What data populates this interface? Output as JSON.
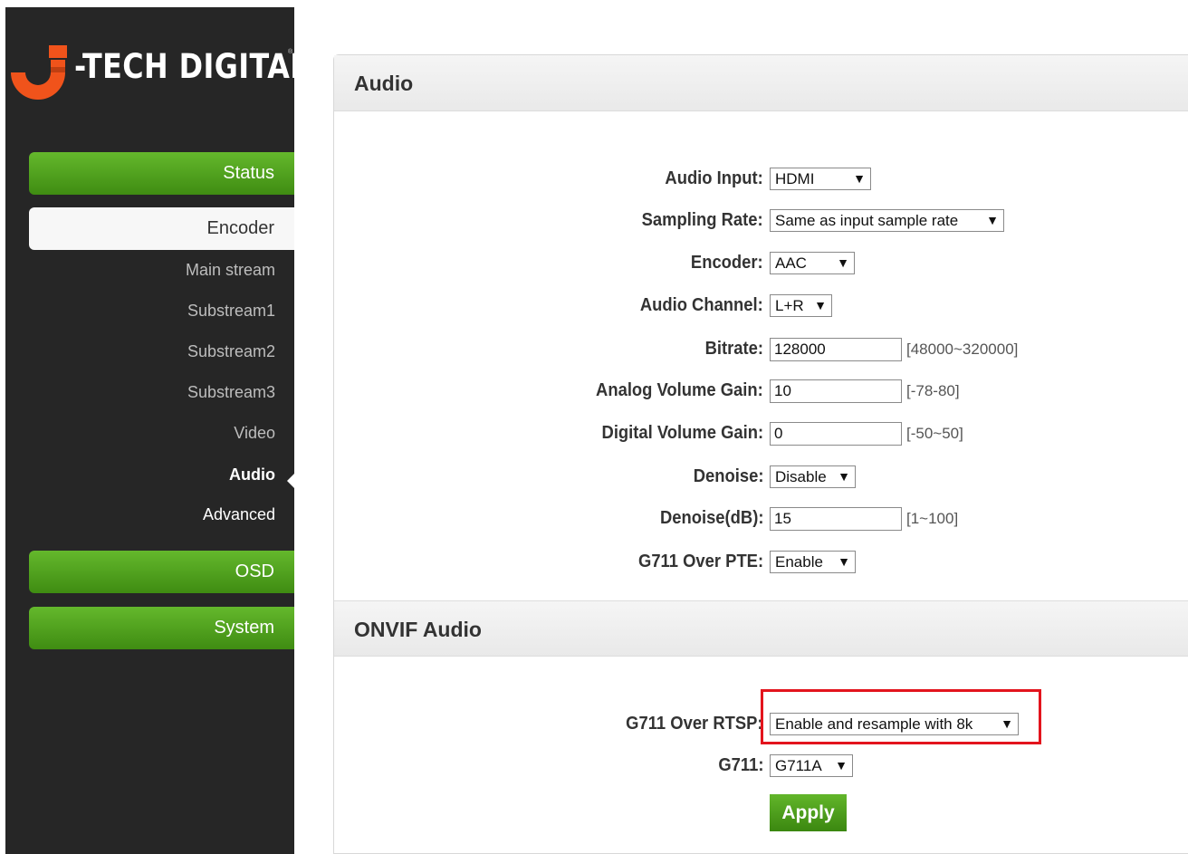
{
  "brand": {
    "logo_text": "-TECH DIGITAL",
    "trademark": "®",
    "accent_color": "#f0531b",
    "button_green": "#4fa01d"
  },
  "sidebar": {
    "status": "Status",
    "encoder": "Encoder",
    "encoder_items": {
      "main_stream": "Main stream",
      "substream1": "Substream1",
      "substream2": "Substream2",
      "substream3": "Substream3",
      "video": "Video",
      "audio": "Audio",
      "advanced": "Advanced"
    },
    "osd": "OSD",
    "system": "System"
  },
  "audio": {
    "title": "Audio",
    "fields": {
      "audio_input": {
        "label": "Audio Input:",
        "value": "HDMI"
      },
      "sampling_rate": {
        "label": "Sampling Rate:",
        "value": "Same as input sample rate"
      },
      "encoder": {
        "label": "Encoder:",
        "value": "AAC"
      },
      "audio_channel": {
        "label": "Audio Channel:",
        "value": "L+R"
      },
      "bitrate": {
        "label": "Bitrate:",
        "value": "128000",
        "hint": "[48000~320000]"
      },
      "analog_volume_gain": {
        "label": "Analog Volume Gain:",
        "value": "10",
        "hint": "[-78-80]"
      },
      "digital_volume_gain": {
        "label": "Digital Volume Gain:",
        "value": "0",
        "hint": "[-50~50]"
      },
      "denoise": {
        "label": "Denoise:",
        "value": "Disable"
      },
      "denoise_db": {
        "label": "Denoise(dB):",
        "value": "15",
        "hint": "[1~100]"
      },
      "g711_over_pte": {
        "label": "G711 Over PTE:",
        "value": "Enable"
      }
    }
  },
  "onvif": {
    "title": "ONVIF Audio",
    "fields": {
      "g711_over_rtsp": {
        "label": "G711 Over RTSP:",
        "value": "Enable and resample with 8k"
      },
      "g711": {
        "label": "G711:",
        "value": "G711A"
      }
    },
    "apply": "Apply"
  },
  "icons": {
    "dropdown": "chevron-down-icon",
    "logo": "j-logo-icon"
  }
}
